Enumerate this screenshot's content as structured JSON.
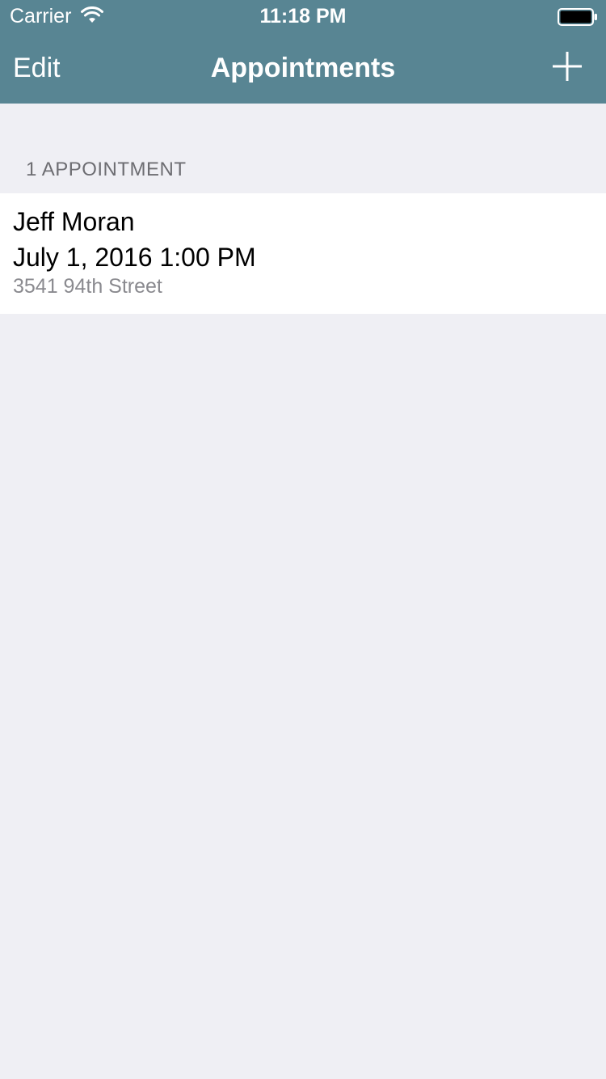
{
  "status_bar": {
    "carrier": "Carrier",
    "time": "11:18 PM",
    "icons": [
      "wifi-icon",
      "battery-icon"
    ]
  },
  "nav_bar": {
    "edit_label": "Edit",
    "title": "Appointments",
    "add_icon": "plus-icon"
  },
  "section": {
    "header": "1 APPOINTMENT"
  },
  "appointments": [
    {
      "name": "Jeff Moran",
      "datetime": "July 1, 2016 1:00 PM",
      "address": "3541 94th Street"
    }
  ],
  "colors": {
    "nav_background": "#588593",
    "page_background": "#efeff4",
    "secondary_text": "#8a8a8f"
  }
}
